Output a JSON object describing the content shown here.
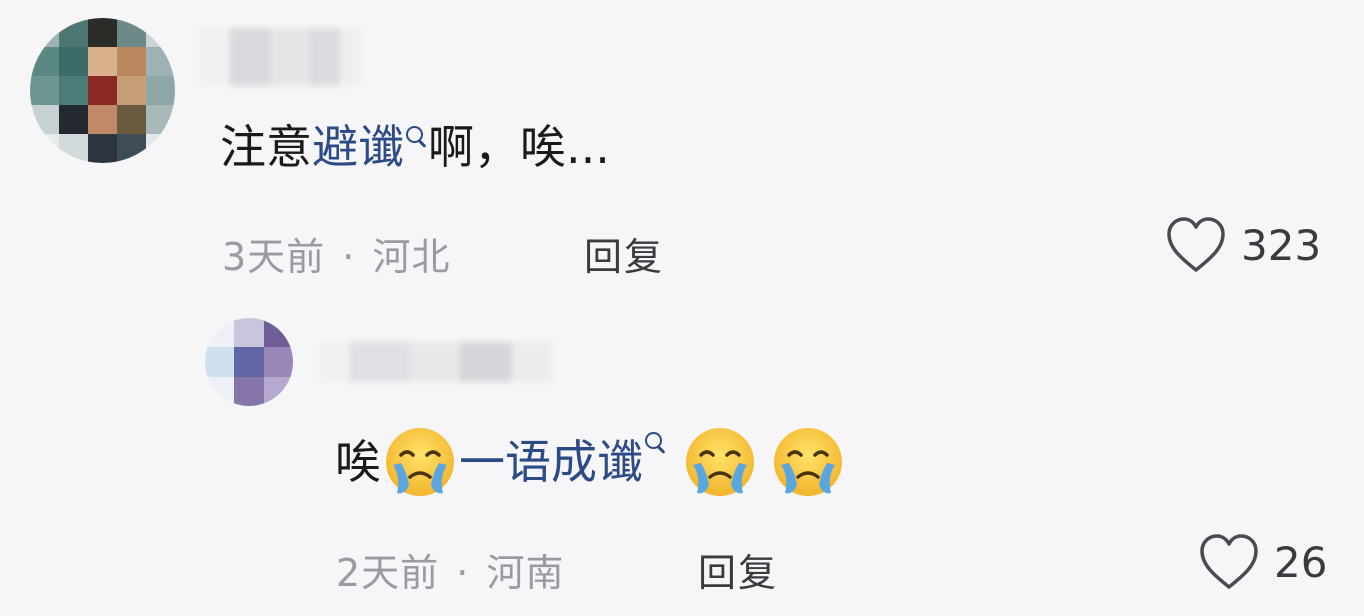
{
  "comments": [
    {
      "text_plain_before": "注意",
      "text_keyword": "避谶",
      "text_plain_after": "啊，唉...",
      "time": "3天前",
      "separator": "·",
      "location": "河北",
      "reply_label": "回复",
      "like_count": "323"
    },
    {
      "text_plain_before": "唉",
      "text_keyword": "一语成谶",
      "time": "2天前",
      "separator": "·",
      "location": "河南",
      "reply_label": "回复",
      "like_count": "26"
    }
  ],
  "icons": {
    "search": "search-icon",
    "heart": "heart-outline-icon",
    "emoji": "crying-face-emoji"
  },
  "colors": {
    "background": "#f6f6f8",
    "keyword_link": "#2b4a86",
    "meta_text": "#9a9aa2",
    "primary_text": "#1a1a1a"
  }
}
